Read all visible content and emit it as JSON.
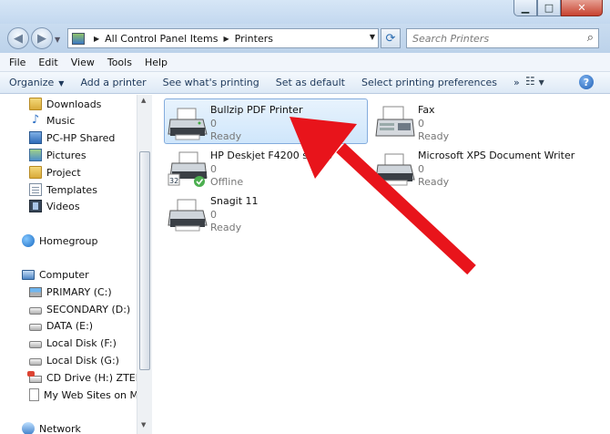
{
  "window": {
    "caption_buttons": {
      "minimize": "▁",
      "maximize": "□",
      "close": "✕"
    }
  },
  "address": {
    "crumbs": [
      "All Control Panel Items",
      "Printers"
    ],
    "search_placeholder": "Search Printers"
  },
  "menu": [
    "File",
    "Edit",
    "View",
    "Tools",
    "Help"
  ],
  "commands": {
    "organize": "Organize",
    "add_printer": "Add a printer",
    "see_printing": "See what's printing",
    "set_default": "Set as default",
    "printing_prefs": "Select printing preferences",
    "more": "»",
    "help": "?"
  },
  "nav": {
    "libraries": [
      "Downloads",
      "Music",
      "PC-HP Shared",
      "Pictures",
      "Project",
      "Templates",
      "Videos"
    ],
    "homegroup": "Homegroup",
    "computer": "Computer",
    "drives": [
      "PRIMARY (C:)",
      "SECONDARY (D:)",
      "DATA (E:)",
      "Local Disk (F:)",
      "Local Disk (G:)",
      "CD Drive (H:) ZTEMC",
      "My Web Sites on MS"
    ],
    "network": "Network"
  },
  "printers": [
    {
      "name": "Bullzip PDF Printer",
      "docs": "0",
      "status": "Ready",
      "selected": true,
      "icon": "printer-icon"
    },
    {
      "name": "Fax",
      "docs": "0",
      "status": "Ready",
      "selected": false,
      "icon": "fax-icon"
    },
    {
      "name": "HP Deskjet F4200 series",
      "docs": "0",
      "status": "Offline",
      "selected": false,
      "icon": "printer-icon"
    },
    {
      "name": "Microsoft XPS Document Writer",
      "docs": "0",
      "status": "Ready",
      "selected": false,
      "icon": "printer-icon"
    },
    {
      "name": "Snagit 11",
      "docs": "0",
      "status": "Ready",
      "selected": false,
      "icon": "printer-icon"
    }
  ],
  "colors": {
    "annotation_arrow": "#e8141b",
    "selection_border": "#84acdd"
  }
}
